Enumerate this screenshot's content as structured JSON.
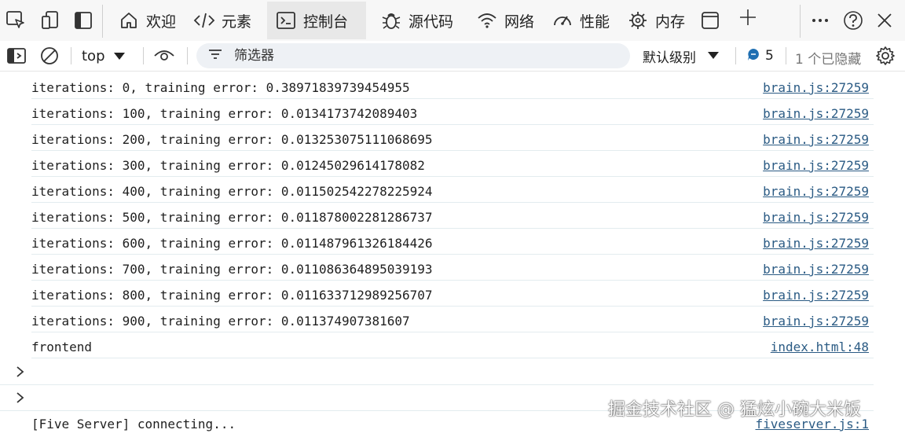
{
  "tabbar": {
    "left_icons": [
      "inspect-element-icon",
      "device-emulation-icon",
      "dock-sidebar-icon"
    ],
    "tabs": [
      {
        "label": "欢迎",
        "icon": "home-icon",
        "active": false
      },
      {
        "label": "元素",
        "icon": "code-tag-icon",
        "active": false
      },
      {
        "label": "控制台",
        "icon": "console-icon",
        "active": true
      },
      {
        "label": "源代码",
        "icon": "bug-icon",
        "active": false
      },
      {
        "label": "网络",
        "icon": "wifi-icon",
        "active": false
      },
      {
        "label": "性能",
        "icon": "gauge-icon",
        "active": false
      },
      {
        "label": "内存",
        "icon": "chip-icon",
        "active": false
      }
    ],
    "right_icons": [
      "panel-icon",
      "add-tab-icon",
      "more-icon",
      "help-icon",
      "close-icon"
    ]
  },
  "toolbar": {
    "context": "top",
    "filter_placeholder": "筛选器",
    "log_level": "默认级别",
    "message_count": "5",
    "hidden_count": "1 个已隐藏"
  },
  "console": {
    "logs": [
      {
        "message": "iterations: 0, training error: 0.38971839739454955",
        "source": "brain.js:27259"
      },
      {
        "message": "iterations: 100, training error: 0.0134173742089403",
        "source": "brain.js:27259"
      },
      {
        "message": "iterations: 200, training error: 0.013253075111068695",
        "source": "brain.js:27259"
      },
      {
        "message": "iterations: 300, training error: 0.01245029614178082",
        "source": "brain.js:27259"
      },
      {
        "message": "iterations: 400, training error: 0.011502542278225924",
        "source": "brain.js:27259"
      },
      {
        "message": "iterations: 500, training error: 0.011878002281286737",
        "source": "brain.js:27259"
      },
      {
        "message": "iterations: 600, training error: 0.011487961326184426",
        "source": "brain.js:27259"
      },
      {
        "message": "iterations: 700, training error: 0.011086364895039193",
        "source": "brain.js:27259"
      },
      {
        "message": "iterations: 800, training error: 0.011633712989256707",
        "source": "brain.js:27259"
      },
      {
        "message": "iterations: 900, training error: 0.011374907381607",
        "source": "brain.js:27259"
      },
      {
        "message": "frontend",
        "source": "index.html:48"
      }
    ],
    "last_log": {
      "message": "[Five Server] connecting...",
      "source": "fiveserver.js:1"
    }
  },
  "watermark": "掘金技术社区 @ 猛炫小碗大米饭",
  "colors": {
    "link": "#2b5b84",
    "badge": "#1f6fb2",
    "row_border": "#e3ecef",
    "active_tab": "#e8e8e8"
  }
}
